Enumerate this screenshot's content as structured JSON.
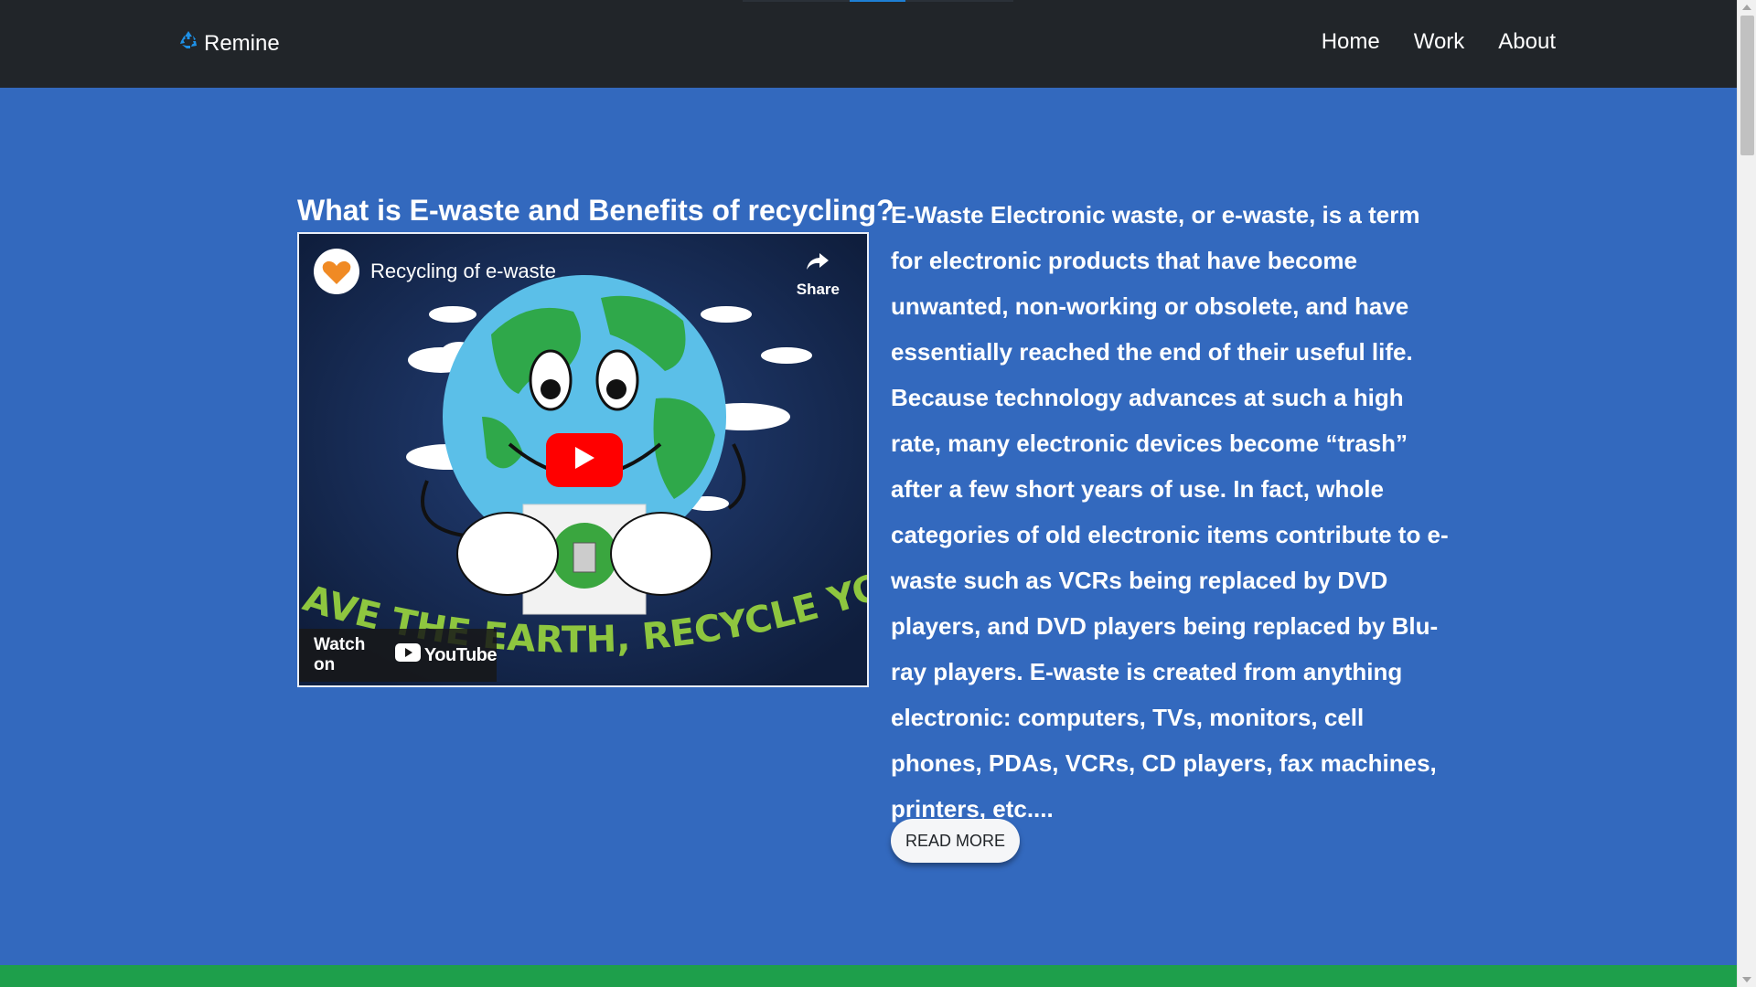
{
  "nav": {
    "brand": "Remine",
    "links": [
      "Home",
      "Work",
      "About"
    ]
  },
  "main": {
    "title": "What is E-waste and Benefits of recycling?",
    "video": {
      "title": "Recycling of e-waste",
      "share_label": "Share",
      "watch_on_label": "Watch on",
      "youtube_label": "YouTube",
      "slogan_text": "AVE THE EARTH, RECYCLE YOUR E-WAST"
    },
    "description": "E-Waste Electronic waste, or e-waste, is a term for electronic products that have become unwanted, non-working or obsolete, and have essentially reached the end of their useful life. Because technology advances at such a high rate, many electronic devices become “trash” after a few short years of use. In fact, whole categories of old electronic items contribute to e-waste such as VCRs being replaced by DVD players, and DVD players being replaced by Blu-ray players. E-waste is created from anything electronic: computers, TVs, monitors, cell phones, PDAs, VCRs, CD players, fax machines, printers, etc....",
    "read_more_label": "READ MORE"
  },
  "colors": {
    "navbar": "#212529",
    "page_background": "#3369be",
    "accent_blue": "#1e7fd4",
    "play_button": "#ff0000",
    "footer_band": "#1e9f4b"
  },
  "icons": [
    "recycle-icon",
    "share-icon",
    "play-icon",
    "youtube-icon"
  ]
}
